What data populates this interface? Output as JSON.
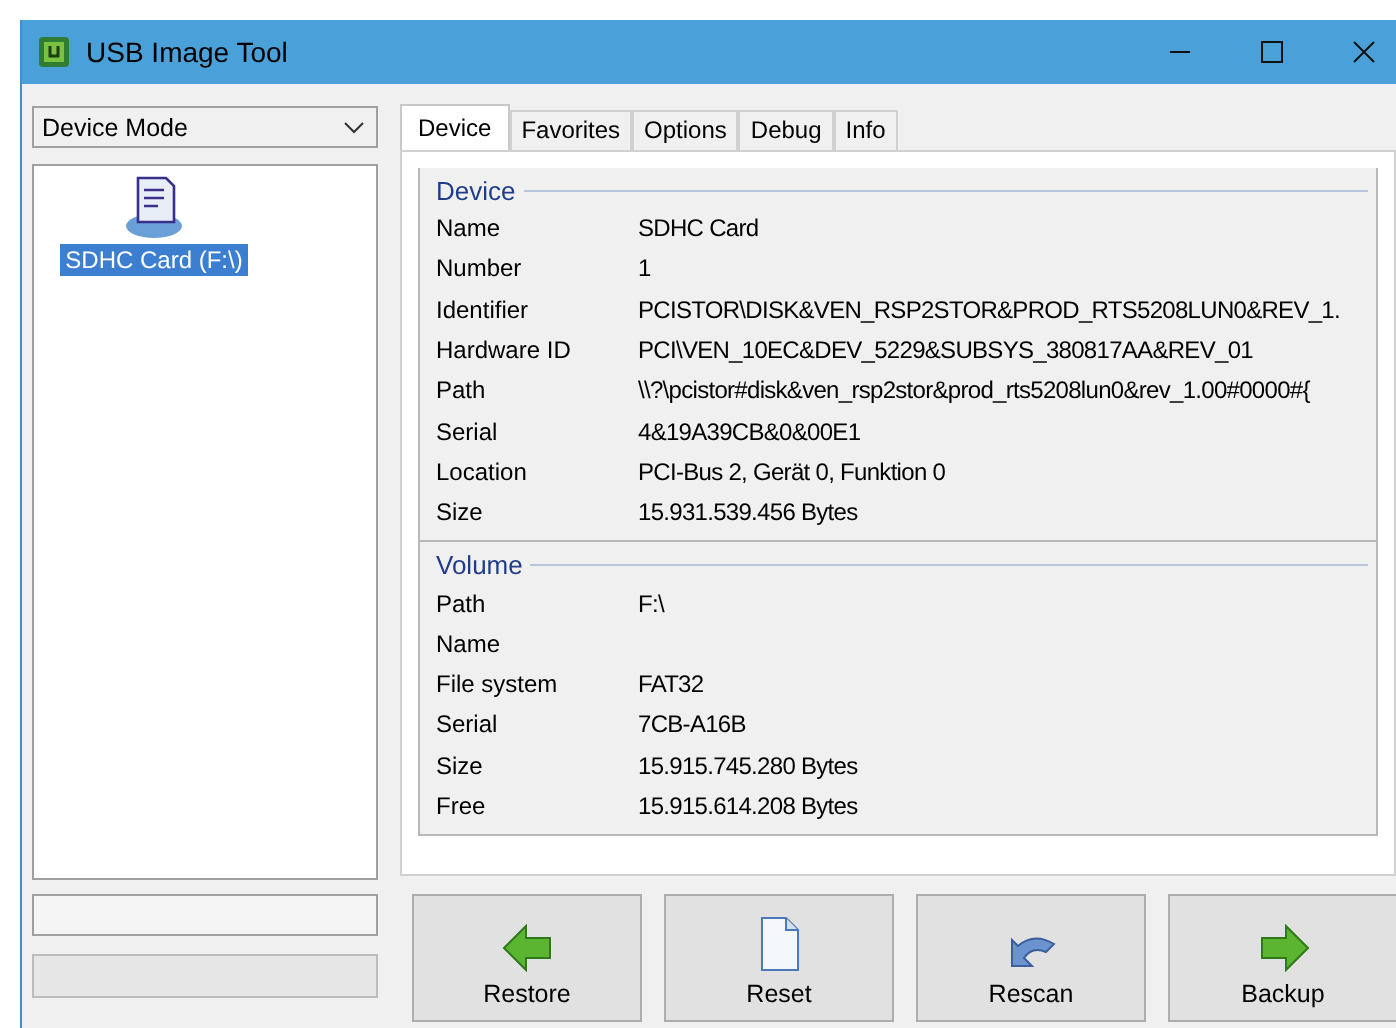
{
  "window": {
    "title": "USB Image Tool"
  },
  "mode_dropdown": {
    "value": "Device Mode"
  },
  "device_list": [
    {
      "label": "SDHC Card (F:\\)",
      "selected": true
    }
  ],
  "tabs": [
    {
      "label": "Device",
      "selected": true
    },
    {
      "label": "Favorites",
      "selected": false
    },
    {
      "label": "Options",
      "selected": false
    },
    {
      "label": "Debug",
      "selected": false
    },
    {
      "label": "Info",
      "selected": false
    }
  ],
  "groups": [
    {
      "title": "Device",
      "rows": [
        {
          "label": "Name",
          "value": "SDHC Card"
        },
        {
          "label": "Number",
          "value": "1"
        },
        {
          "label": "Identifier",
          "value": "PCISTOR\\DISK&VEN_RSP2STOR&PROD_RTS5208LUN0&REV_1."
        },
        {
          "label": "Hardware ID",
          "value": "PCI\\VEN_10EC&DEV_5229&SUBSYS_380817AA&REV_01"
        },
        {
          "label": "Path",
          "value": "\\\\?\\pcistor#disk&ven_rsp2stor&prod_rts5208lun0&rev_1.00#0000#{"
        },
        {
          "label": "Serial",
          "value": "4&19A39CB&0&00E1"
        },
        {
          "label": "Location",
          "value": "PCI-Bus 2, Gerät 0, Funktion 0"
        },
        {
          "label": "Size",
          "value": "15.931.539.456 Bytes"
        }
      ]
    },
    {
      "title": "Volume",
      "rows": [
        {
          "label": "Path",
          "value": "F:\\"
        },
        {
          "label": "Name"
        },
        {
          "label": "File system",
          "value": "FAT32"
        },
        {
          "label": "Serial",
          "value": "7CB-A16B"
        },
        {
          "label": "Size",
          "value": "15.915.745.280 Bytes"
        },
        {
          "label": "Free",
          "value": "15.915.614.208 Bytes"
        }
      ]
    }
  ],
  "buttons": [
    {
      "label": "Restore",
      "kind": "restore"
    },
    {
      "label": "Reset",
      "kind": "reset"
    },
    {
      "label": "Rescan",
      "kind": "rescan"
    },
    {
      "label": "Backup",
      "kind": "backup"
    }
  ]
}
